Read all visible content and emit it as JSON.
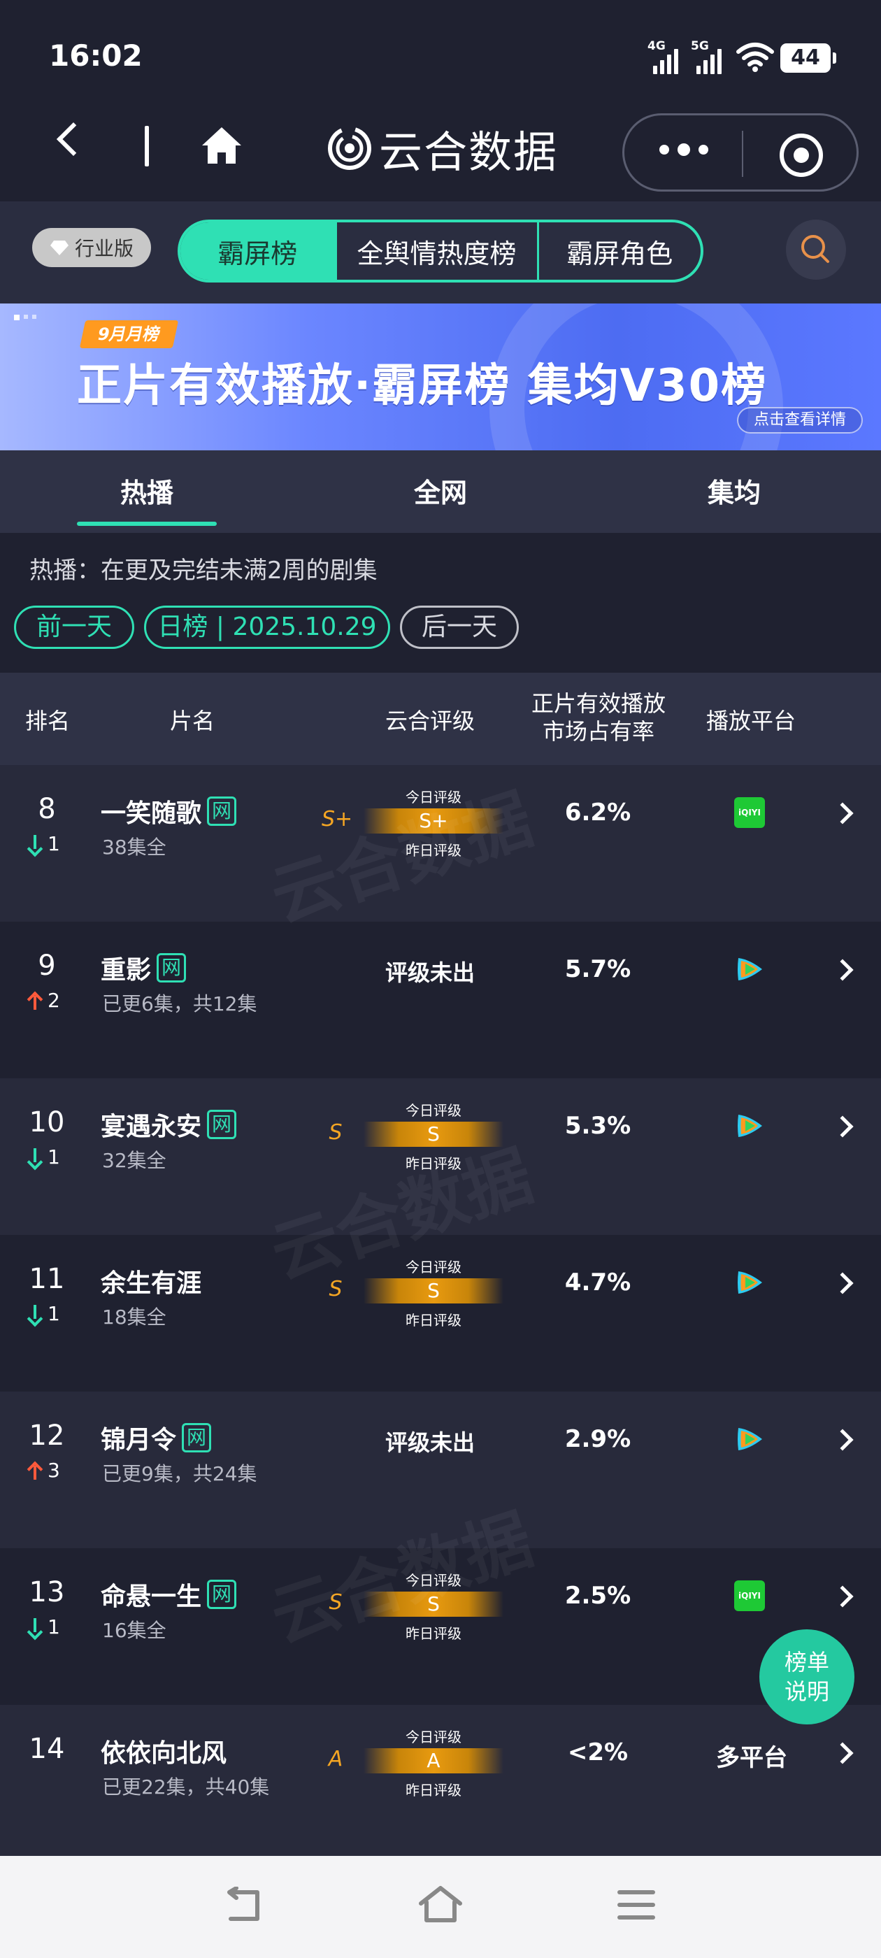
{
  "status": {
    "time": "16:02",
    "net1": "4G",
    "net2": "5G",
    "battery": "44"
  },
  "nav": {
    "brand": "云合数据"
  },
  "tabs": {
    "industry": "行业版",
    "items": [
      "霸屏榜",
      "全舆情热度榜",
      "霸屏角色"
    ],
    "active": 0
  },
  "banner": {
    "tag": "9月月榜",
    "title": "正片有效播放·霸屏榜 集均V30榜",
    "link": "点击查看详情"
  },
  "subtabs": [
    "热播",
    "全网",
    "集均"
  ],
  "desc": "热播：在更及完结未满2周的剧集",
  "dates": {
    "prev": "前一天",
    "current": "日榜 | 2025.10.29",
    "next": "后一天"
  },
  "table_header": {
    "rank": "排名",
    "name": "片名",
    "rating": "云合评级",
    "share_l1": "正片有效播放",
    "share_l2": "市场占有率",
    "platform": "播放平台"
  },
  "rating_labels": {
    "today": "今日评级",
    "yesterday": "昨日评级",
    "none": "评级未出"
  },
  "net_badge": "网",
  "rows": [
    {
      "rank": "8",
      "change": "1",
      "dir": "down",
      "title": "一笑随歌",
      "net": true,
      "sub": "38集全",
      "grade": "S+",
      "rating": "S+",
      "share": "6.2%",
      "platform": "iqiyi"
    },
    {
      "rank": "9",
      "change": "2",
      "dir": "up",
      "title": "重影",
      "net": true,
      "sub": "已更6集，共12集",
      "grade": "",
      "rating": "",
      "share": "5.7%",
      "platform": "tencent"
    },
    {
      "rank": "10",
      "change": "1",
      "dir": "down",
      "title": "宴遇永安",
      "net": true,
      "sub": "32集全",
      "grade": "S",
      "rating": "S",
      "share": "5.3%",
      "platform": "tencent"
    },
    {
      "rank": "11",
      "change": "1",
      "dir": "down",
      "title": "余生有涯",
      "net": false,
      "sub": "18集全",
      "grade": "S",
      "rating": "S",
      "share": "4.7%",
      "platform": "tencent"
    },
    {
      "rank": "12",
      "change": "3",
      "dir": "up",
      "title": "锦月令",
      "net": true,
      "sub": "已更9集，共24集",
      "grade": "",
      "rating": "",
      "share": "2.9%",
      "platform": "tencent"
    },
    {
      "rank": "13",
      "change": "1",
      "dir": "down",
      "title": "命悬一生",
      "net": true,
      "sub": "16集全",
      "grade": "S",
      "rating": "S",
      "share": "2.5%",
      "platform": "iqiyi"
    },
    {
      "rank": "14",
      "change": "",
      "dir": "",
      "title": "依依向北风",
      "net": false,
      "sub": "已更22集，共40集",
      "grade": "A",
      "rating": "A",
      "share": "<2%",
      "platform": "multi",
      "platform_text": "多平台"
    }
  ],
  "iqiyi_text": "iQIYI",
  "float_btn": {
    "line1": "榜单",
    "line2": "说明"
  },
  "colors": {
    "accent": "#2fe0b4",
    "up": "#ff5a3c",
    "grade": "#f5a623",
    "bg": "#1f2130"
  }
}
